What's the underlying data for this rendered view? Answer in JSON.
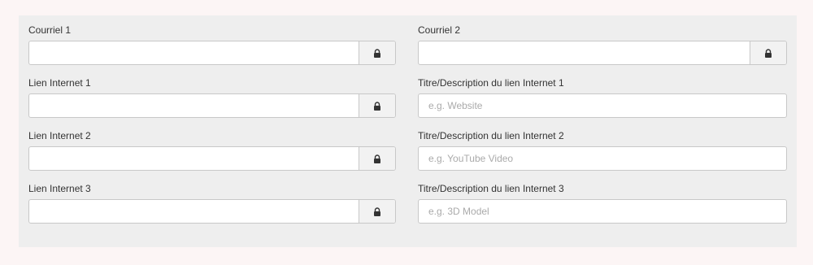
{
  "left": [
    {
      "label": "Courriel 1",
      "value": ""
    },
    {
      "label": "Lien Internet 1",
      "value": ""
    },
    {
      "label": "Lien Internet 2",
      "value": ""
    },
    {
      "label": "Lien Internet 3",
      "value": ""
    }
  ],
  "right": [
    {
      "label": "Courriel 2",
      "value": "",
      "placeholder": ""
    },
    {
      "label": "Titre/Description du lien Internet 1",
      "value": "",
      "placeholder": "e.g. Website"
    },
    {
      "label": "Titre/Description du lien Internet 2",
      "value": "",
      "placeholder": "e.g. YouTube Video"
    },
    {
      "label": "Titre/Description du lien Internet 3",
      "value": "",
      "placeholder": "e.g. 3D Model"
    }
  ],
  "icons": {
    "lock": "lock-icon",
    "checkbox": "privacy-checkbox"
  }
}
